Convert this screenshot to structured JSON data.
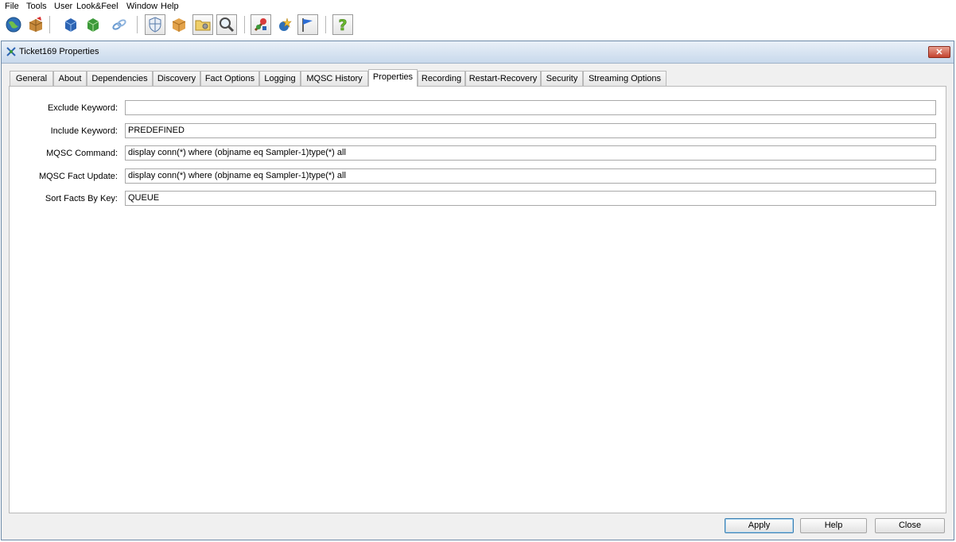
{
  "menu": [
    "File",
    "Tools",
    "User",
    "Look&Feel",
    "Window",
    "Help"
  ],
  "toolbar_icons": [
    "globe-icon",
    "box-open-icon",
    "blue-cube-icon",
    "green-cube-icon",
    "link-icon",
    "shield-icon",
    "package-icon",
    "folder-gear-icon",
    "magnifier-icon",
    "tools-icon",
    "wizard-icon",
    "flag-icon",
    "help-icon"
  ],
  "window": {
    "title": "Ticket169 Properties",
    "close_label": "✕"
  },
  "tabs": [
    "General",
    "About",
    "Dependencies",
    "Discovery",
    "Fact Options",
    "Logging",
    "MQSC History",
    "Properties",
    "Recording",
    "Restart-Recovery",
    "Security",
    "Streaming Options"
  ],
  "active_tab": "Properties",
  "fields": [
    {
      "label": "Exclude Keyword:",
      "value": ""
    },
    {
      "label": "Include Keyword:",
      "value": "PREDEFINED"
    },
    {
      "label": "MQSC Command:",
      "value": "display conn(*) where (objname eq Sampler-1)type(*) all"
    },
    {
      "label": "MQSC Fact Update:",
      "value": "display conn(*) where (objname eq Sampler-1)type(*) all"
    },
    {
      "label": "Sort Facts By Key:",
      "value": "QUEUE"
    }
  ],
  "buttons": {
    "apply": "Apply",
    "help": "Help",
    "close": "Close"
  }
}
